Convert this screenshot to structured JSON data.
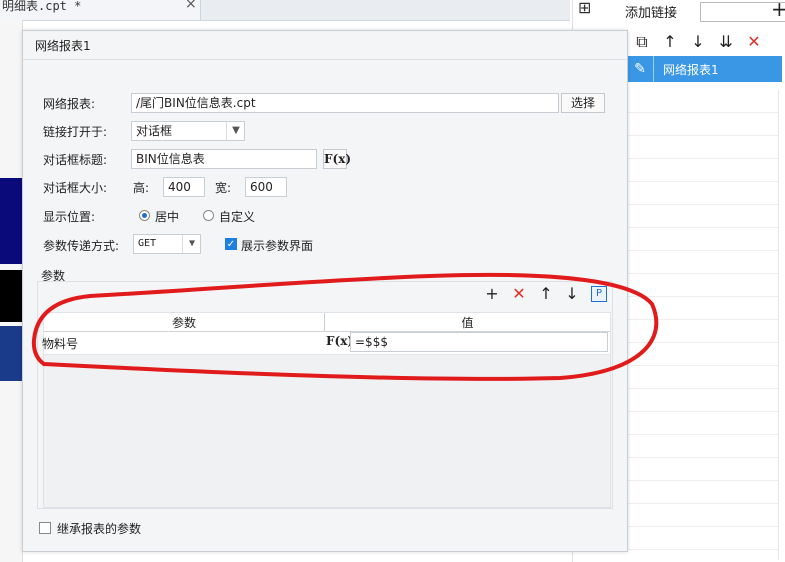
{
  "editor": {
    "tab_title": "明细表.cpt *",
    "tab_close": "×"
  },
  "panel": {
    "title": "添加链接",
    "plus": "+",
    "toolbar": {
      "copy": "⧉",
      "up": "↑",
      "down": "↓",
      "sort": "⇊",
      "delete": "✕"
    },
    "link_item": {
      "label": "网络报表1",
      "icon": "✎"
    }
  },
  "dialog": {
    "title": "网络报表1",
    "report": {
      "label": "网络报表:",
      "value": "/尾门BIN位信息表.cpt",
      "button": "选择"
    },
    "open_in": {
      "label": "链接打开于:",
      "value": "对话框"
    },
    "dialog_title": {
      "label": "对话框标题:",
      "value": "BIN位信息表",
      "fx": "F(x)"
    },
    "dialog_size": {
      "label": "对话框大小:",
      "height_label": "高:",
      "height": "400",
      "width_label": "宽:",
      "width": "600"
    },
    "position": {
      "label": "显示位置:",
      "center": "居中",
      "custom": "自定义",
      "selected": "center"
    },
    "method": {
      "label": "参数传递方式:",
      "value": "GET",
      "show_params": "展示参数界面",
      "show_params_checked": true
    },
    "params": {
      "section_label": "参数",
      "toolbar": {
        "add": "+",
        "delete": "✕",
        "up": "↑",
        "down": "↓",
        "param": "P"
      },
      "columns": [
        "参数",
        "值"
      ],
      "rows": [
        {
          "name": "物料号",
          "fx": "F(x)",
          "value": "=$$$"
        }
      ]
    },
    "inherit": {
      "label": "继承报表的参数",
      "checked": false
    }
  },
  "colors": {
    "accent": "#3a97e6",
    "delete_red": "#e0312a",
    "annotation_red": "#e11b1b"
  }
}
